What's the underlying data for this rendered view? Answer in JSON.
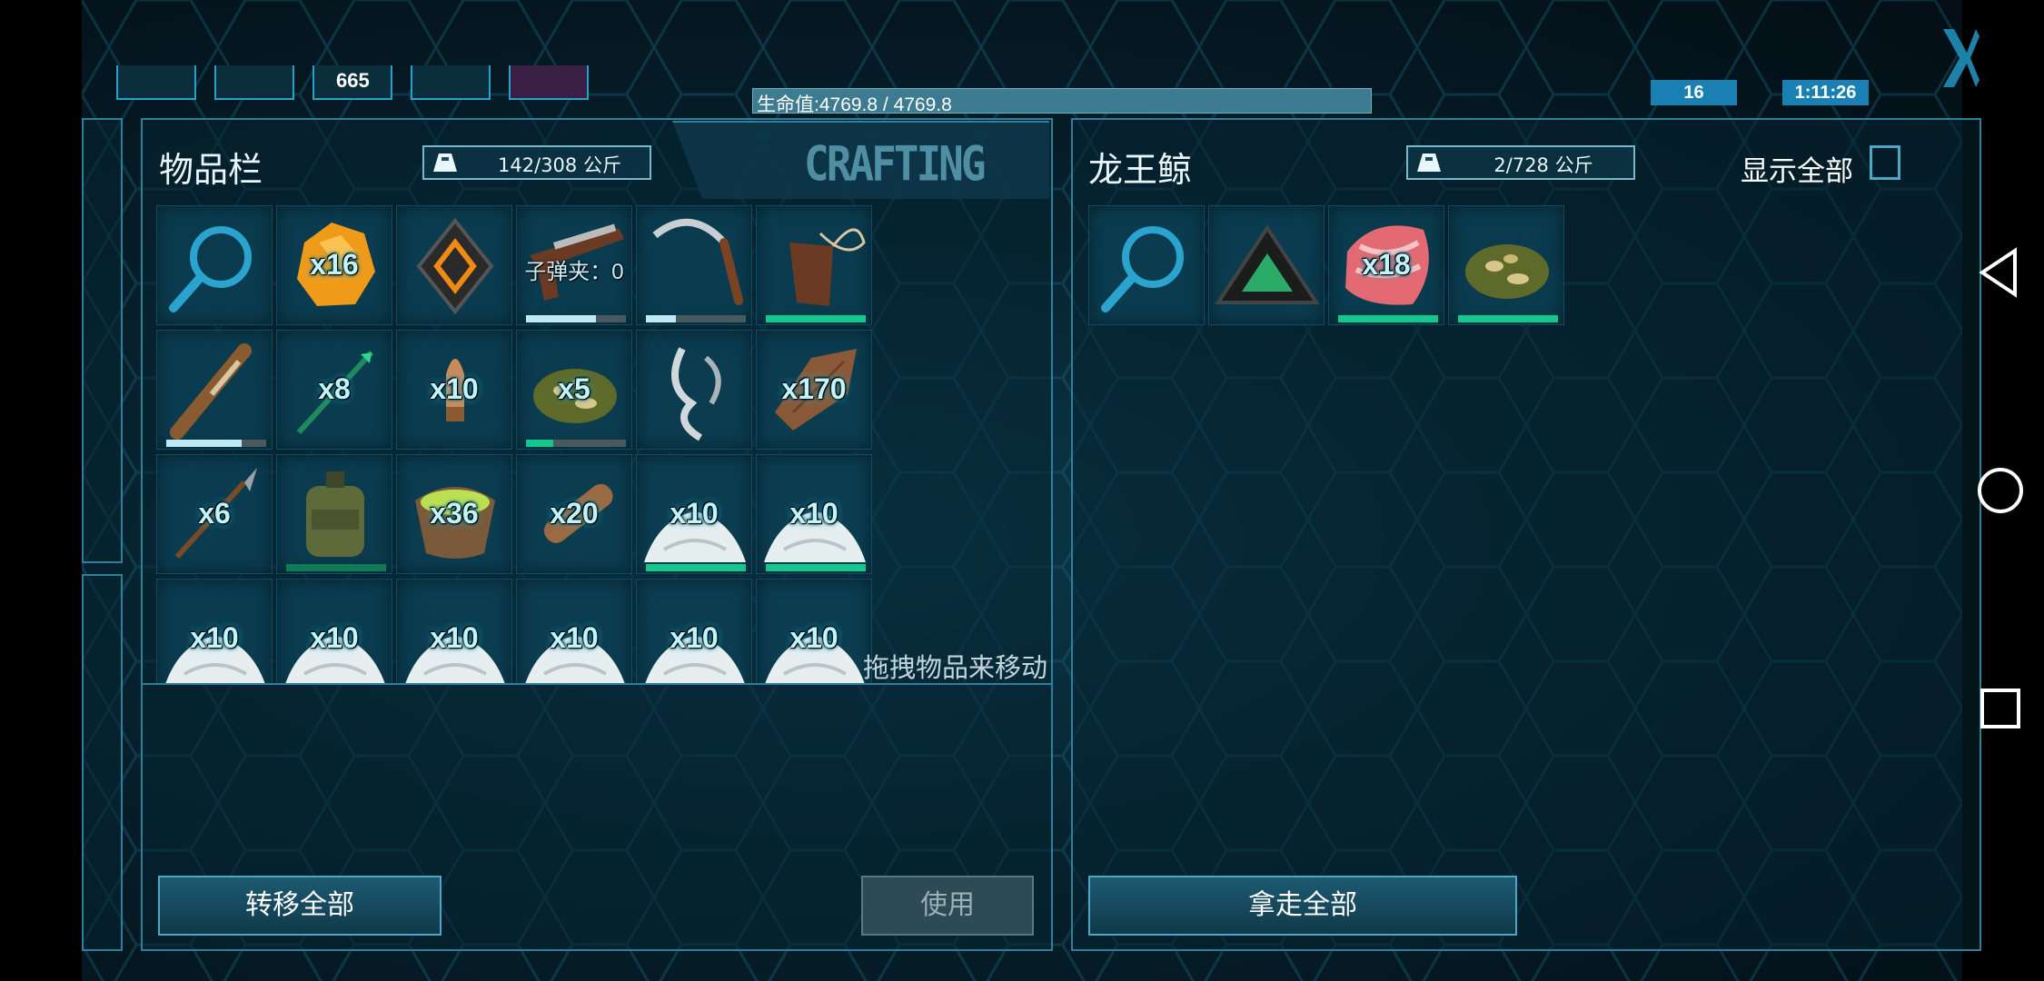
{
  "hud": {
    "level_icon_text": "665",
    "health_label": "生命值:4769.8 / 4769.8",
    "day_badge": "16",
    "time_badge": "1:11:26",
    "health_fraction": 1.0
  },
  "inventory": {
    "title": "物品栏",
    "weight": "142/308 公斤",
    "crafting_tab": "CRAFTING",
    "hint": "拖拽物品来移动",
    "transfer_all": "转移全部",
    "use": "使用",
    "slots": [
      {
        "icon": "magnifier-icon",
        "label": ""
      },
      {
        "icon": "amber-icon",
        "label": "x16"
      },
      {
        "icon": "implant-icon",
        "label": ""
      },
      {
        "icon": "pistol-icon",
        "label": "子弹夹：0",
        "durability": 0.7,
        "bar_color": "#bde9f5"
      },
      {
        "icon": "sickle-icon",
        "label": "",
        "durability": 0.3,
        "bar_color": "#bde9f5"
      },
      {
        "icon": "whip-icon",
        "label": "",
        "durability": 1.0,
        "bar_color": "#12c88f"
      },
      {
        "icon": "club-icon",
        "label": "",
        "durability": 0.75,
        "bar_color": "#bde9f5"
      },
      {
        "icon": "tranq-arrow-icon",
        "label": "x8"
      },
      {
        "icon": "bullet-icon",
        "label": "x10"
      },
      {
        "icon": "spoiled-meat-icon",
        "label": "x5",
        "durability": 0.27,
        "bar_color": "#12c88f"
      },
      {
        "icon": "ghillie-icon",
        "label": ""
      },
      {
        "icon": "hide-icon",
        "label": "x170"
      },
      {
        "icon": "spear-icon",
        "label": "x6"
      },
      {
        "icon": "canteen-icon",
        "label": "",
        "durability": 1.0,
        "bar_color": "#0f7a55"
      },
      {
        "icon": "sap-icon",
        "label": "x36"
      },
      {
        "icon": "wood-icon",
        "label": "x20"
      },
      {
        "icon": "snow-pile-icon",
        "label": "x10",
        "durability": 1.0,
        "bar_color": "#12c88f"
      },
      {
        "icon": "snow-pile-icon",
        "label": "x10",
        "durability": 1.0,
        "bar_color": "#12c88f"
      },
      {
        "icon": "snow-pile-icon",
        "label": "x10"
      },
      {
        "icon": "snow-pile-icon",
        "label": "x10"
      },
      {
        "icon": "snow-pile-icon",
        "label": "x10"
      },
      {
        "icon": "snow-pile-icon",
        "label": "x10"
      },
      {
        "icon": "snow-pile-icon",
        "label": "x10"
      },
      {
        "icon": "snow-pile-icon",
        "label": "x10"
      }
    ]
  },
  "remote": {
    "title": "龙王鲸",
    "weight": "2/728 公斤",
    "show_all": "显示全部",
    "take_all": "拿走全部",
    "slots": [
      {
        "icon": "magnifier-icon",
        "label": ""
      },
      {
        "icon": "artifact-icon",
        "label": ""
      },
      {
        "icon": "raw-meat-icon",
        "label": "x18",
        "durability": 1.0,
        "bar_color": "#12c88f"
      },
      {
        "icon": "spoiled-meat-icon",
        "label": "",
        "durability": 1.0,
        "bar_color": "#12c88f"
      }
    ]
  },
  "colors": {
    "accent": "#2e7f9b",
    "health_bar": "#3d7c90",
    "durability": "#12c88f",
    "badge": "#1a7fb2"
  }
}
